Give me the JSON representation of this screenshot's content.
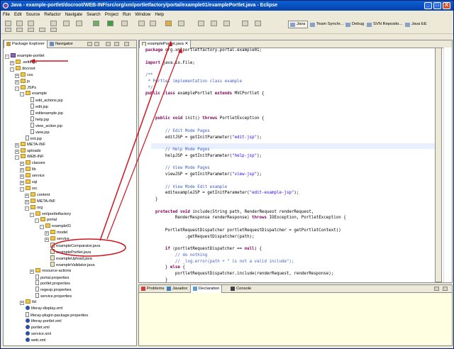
{
  "window": {
    "title": "Java - example-portlet/docroot/WEB-INF/src/org/xmlportletfactory/portal/example01/examplePortlet.java - Eclipse",
    "minimize": "_",
    "maximize": "□",
    "close": "X"
  },
  "menu": [
    "File",
    "Edit",
    "Source",
    "Refactor",
    "Navigate",
    "Search",
    "Project",
    "Run",
    "Window",
    "Help"
  ],
  "perspectives": [
    {
      "label": "Java",
      "icon": "java-perspective-icon",
      "active": true
    },
    {
      "label": "Team Synchr...",
      "icon": "team-sync-icon"
    },
    {
      "label": "Debug",
      "icon": "debug-icon"
    },
    {
      "label": "SVN Reposito...",
      "icon": "svn-icon"
    },
    {
      "label": "Java EE",
      "icon": "java-ee-icon"
    }
  ],
  "left_tabs": [
    "Package Explorer",
    "Navigator"
  ],
  "tree": [
    {
      "label": "example-portlet",
      "depth": 0,
      "type": "project",
      "toggle": "-"
    },
    {
      "label": ".settings",
      "depth": 1,
      "type": "folder",
      "toggle": "+"
    },
    {
      "label": "docroot",
      "depth": 1,
      "type": "folder",
      "toggle": "-"
    },
    {
      "label": "css",
      "depth": 2,
      "type": "folder",
      "toggle": "+"
    },
    {
      "label": "js",
      "depth": 2,
      "type": "folder",
      "toggle": "+"
    },
    {
      "label": "JSPs",
      "depth": 2,
      "type": "folder",
      "toggle": "-"
    },
    {
      "label": "example",
      "depth": 3,
      "type": "folder",
      "toggle": "-"
    },
    {
      "label": "edit_actions.jsp",
      "depth": 4,
      "type": "file"
    },
    {
      "label": "edit.jsp",
      "depth": 4,
      "type": "file"
    },
    {
      "label": "editexample.jsp",
      "depth": 4,
      "type": "file"
    },
    {
      "label": "help.jsp",
      "depth": 4,
      "type": "file"
    },
    {
      "label": "view_action.jsp",
      "depth": 4,
      "type": "file"
    },
    {
      "label": "view.jsp",
      "depth": 4,
      "type": "file"
    },
    {
      "label": "init.jsp",
      "depth": 3,
      "type": "file"
    },
    {
      "label": "META-INF",
      "depth": 2,
      "type": "folder",
      "toggle": "+"
    },
    {
      "label": "uploads",
      "depth": 2,
      "type": "folder",
      "toggle": "+"
    },
    {
      "label": "WEB-INF",
      "depth": 2,
      "type": "folder",
      "toggle": "-"
    },
    {
      "label": "classes",
      "depth": 3,
      "type": "folder",
      "toggle": "+"
    },
    {
      "label": "lib",
      "depth": 3,
      "type": "folder",
      "toggle": "+"
    },
    {
      "label": "service",
      "depth": 3,
      "type": "folder",
      "toggle": "+"
    },
    {
      "label": "sql",
      "depth": 3,
      "type": "folder",
      "toggle": "+"
    },
    {
      "label": "src",
      "depth": 3,
      "type": "folder",
      "toggle": "-"
    },
    {
      "label": "content",
      "depth": 4,
      "type": "folder",
      "toggle": "+"
    },
    {
      "label": "META-INF",
      "depth": 4,
      "type": "folder",
      "toggle": "+"
    },
    {
      "label": "org",
      "depth": 4,
      "type": "folder",
      "toggle": "-"
    },
    {
      "label": "xmlportletfactory",
      "depth": 5,
      "type": "folder",
      "toggle": "-"
    },
    {
      "label": "portal",
      "depth": 6,
      "type": "folder",
      "toggle": "-"
    },
    {
      "label": "example01",
      "depth": 7,
      "type": "folder",
      "toggle": "-"
    },
    {
      "label": "model",
      "depth": 8,
      "type": "folder",
      "toggle": "+"
    },
    {
      "label": "service",
      "depth": 8,
      "type": "folder",
      "toggle": "+"
    },
    {
      "label": "exampleComparator.java",
      "depth": 8,
      "type": "java"
    },
    {
      "label": "examplePortlet.java",
      "depth": 8,
      "type": "java"
    },
    {
      "label": "exampleUpload.java",
      "depth": 8,
      "type": "java"
    },
    {
      "label": "exampleValidator.java",
      "depth": 8,
      "type": "java"
    },
    {
      "label": "resource-actions",
      "depth": 5,
      "type": "folder",
      "toggle": "+"
    },
    {
      "label": "portal.properties",
      "depth": 5,
      "type": "file"
    },
    {
      "label": "portlet.properties",
      "depth": 5,
      "type": "file"
    },
    {
      "label": "regexp.properties",
      "depth": 5,
      "type": "file"
    },
    {
      "label": "service.properties",
      "depth": 5,
      "type": "file"
    },
    {
      "label": "tld",
      "depth": 3,
      "type": "folder",
      "toggle": "+"
    },
    {
      "label": "liferay-display.xml",
      "depth": 3,
      "type": "xml"
    },
    {
      "label": "liferay-plugin-package.properties",
      "depth": 3,
      "type": "file"
    },
    {
      "label": "liferay-portlet.xml",
      "depth": 3,
      "type": "xml"
    },
    {
      "label": "portlet.xml",
      "depth": 3,
      "type": "xml"
    },
    {
      "label": "service.xml",
      "depth": 3,
      "type": "xml"
    },
    {
      "label": "web.xml",
      "depth": 3,
      "type": "xml"
    }
  ],
  "editor": {
    "tab": "examplePortlet.java",
    "lines": [
      [
        [
          "kw",
          "package"
        ],
        [
          "t",
          " org.xmlportletfactory.portal.example01;"
        ]
      ],
      [],
      [
        [
          "kw",
          "import"
        ],
        [
          "t",
          " java.io.File;"
        ]
      ],
      [],
      [
        [
          "cm",
          "/**"
        ]
      ],
      [
        [
          "cm",
          " * Portlet implementation class example"
        ]
      ],
      [
        [
          "cm",
          " */"
        ]
      ],
      [
        [
          "kw",
          "public class"
        ],
        [
          "t",
          " examplePortlet "
        ],
        [
          "kw",
          "extends"
        ],
        [
          "t",
          " MVCPortlet {"
        ]
      ],
      [],
      [],
      [],
      [
        [
          "t",
          "    "
        ],
        [
          "kw",
          "public void"
        ],
        [
          "t",
          " init() "
        ],
        [
          "kw",
          "throws"
        ],
        [
          "t",
          " PortletException {"
        ]
      ],
      [],
      [
        [
          "cm",
          "        // Edit Mode Pages"
        ]
      ],
      [
        [
          "t",
          "        editJSP = getInitParameter("
        ],
        [
          "st",
          "\"edit-jsp\""
        ],
        [
          "t",
          ");"
        ]
      ],
      [],
      [
        [
          "cm",
          "        // Help Mode Pages"
        ]
      ],
      [
        [
          "t",
          "        helpJSP = getInitParameter("
        ],
        [
          "st",
          "\"help-jsp\""
        ],
        [
          "t",
          ");"
        ]
      ],
      [],
      [
        [
          "cm",
          "        // View Mode Pages"
        ]
      ],
      [
        [
          "t",
          "        viewJSP = getInitParameter("
        ],
        [
          "st",
          "\"view-jsp\""
        ],
        [
          "t",
          ");"
        ]
      ],
      [],
      [
        [
          "cm",
          "        // View Mode Edit example"
        ]
      ],
      [
        [
          "t",
          "        editexampleJSP = getInitParameter("
        ],
        [
          "st",
          "\"edit-example-jsp\""
        ],
        [
          "t",
          ");"
        ]
      ],
      [
        [
          "t",
          "    }"
        ]
      ],
      [],
      [
        [
          "t",
          "    "
        ],
        [
          "kw",
          "protected void"
        ],
        [
          "t",
          " include(String path, RenderRequest renderRequest,"
        ]
      ],
      [
        [
          "t",
          "            RenderResponse renderResponse) "
        ],
        [
          "kw",
          "throws"
        ],
        [
          "t",
          " IOException, PortletException {"
        ]
      ],
      [],
      [
        [
          "t",
          "        PortletRequestDispatcher portletRequestDispatcher = getPortletContext()"
        ]
      ],
      [
        [
          "t",
          "                .getRequestDispatcher(path);"
        ]
      ],
      [],
      [
        [
          "t",
          "        "
        ],
        [
          "kw",
          "if"
        ],
        [
          "t",
          " (portletRequestDispatcher == "
        ],
        [
          "kw",
          "null"
        ],
        [
          "t",
          ") {"
        ]
      ],
      [
        [
          "cm",
          "            // do nothing"
        ]
      ],
      [
        [
          "cm",
          "            // _log.error(path + \" is not a valid include\");"
        ]
      ],
      [
        [
          "t",
          "        } "
        ],
        [
          "kw",
          "else"
        ],
        [
          "t",
          " {"
        ]
      ],
      [
        [
          "t",
          "            portletRequestDispatcher.include(renderRequest, renderResponse);"
        ]
      ],
      [
        [
          "t",
          "        }"
        ]
      ]
    ]
  },
  "bottom_tabs": [
    "Problems",
    "Javadoc",
    "Declaration",
    "Console"
  ],
  "colors": {
    "title_bar": "#0a4fd0",
    "annotation": "#d0141e",
    "chrome": "#ece9d8"
  }
}
